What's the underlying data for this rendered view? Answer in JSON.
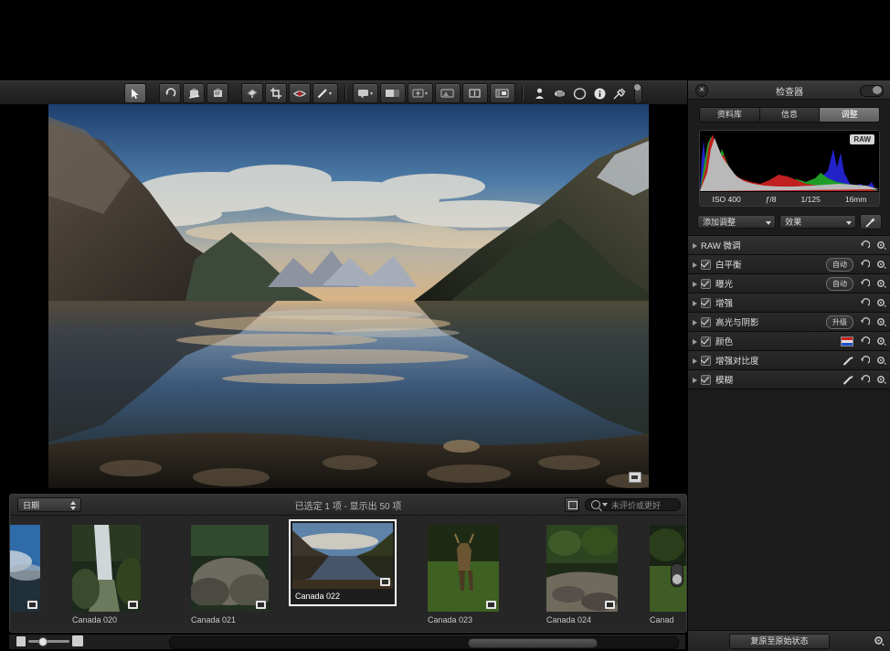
{
  "toolbar": {
    "tools": [
      {
        "name": "select-arrow-tool",
        "selected": true
      },
      {
        "name": "rotate-left-tool",
        "selected": false
      },
      {
        "name": "straighten-tool",
        "selected": false
      },
      {
        "name": "flip-tool",
        "selected": false
      },
      {
        "name": "lift-stamp-tool",
        "selected": false
      },
      {
        "name": "crop-tool",
        "selected": false
      },
      {
        "name": "red-eye-tool",
        "selected": false
      },
      {
        "name": "retouch-brush-tool",
        "selected": false
      },
      {
        "name": "quick-preview-tool",
        "selected": false
      },
      {
        "name": "primary-viewer-tool",
        "selected": false
      },
      {
        "name": "zoom-tool",
        "selected": false
      },
      {
        "name": "compare-tool",
        "selected": false
      },
      {
        "name": "loupe-tool",
        "selected": false
      },
      {
        "name": "metadata-overlay-tool",
        "selected": false
      },
      {
        "name": "full-screen-tool",
        "selected": false
      },
      {
        "name": "keywords-tool",
        "selected": false
      },
      {
        "name": "rotate-view-tool",
        "selected": false
      },
      {
        "name": "info-tool",
        "selected": false
      },
      {
        "name": "color-picker-tool",
        "selected": false
      }
    ]
  },
  "viewer": {
    "photo_alt": "Canada 022 - mountain lake reflection at sunrise",
    "badge_name": "version-badge"
  },
  "filmstrip": {
    "sort_label": "日期",
    "count_text": "已选定 1 项 - 显示出 50 项",
    "search_placeholder": "未评价或更好",
    "search_value": "未评价或更好",
    "thumbnails": [
      {
        "label": "",
        "partial": true,
        "side": "left"
      },
      {
        "label": "Canada 020",
        "selected": false
      },
      {
        "label": "Canada 021",
        "selected": false
      },
      {
        "label": "Canada 022",
        "selected": true
      },
      {
        "label": "Canada 023",
        "selected": false
      },
      {
        "label": "Canada 024",
        "selected": false
      },
      {
        "label": "Canad",
        "selected": false,
        "partial": true,
        "side": "right"
      }
    ]
  },
  "inspector": {
    "title": "检查器",
    "tabs": [
      {
        "label": "资料库",
        "active": false
      },
      {
        "label": "信息",
        "active": false
      },
      {
        "label": "调整",
        "active": true
      }
    ],
    "histogram": {
      "raw_tag": "RAW",
      "exif": [
        "ISO 400",
        "ƒ/8",
        "1/125",
        "16mm"
      ],
      "channels": [
        "red",
        "green",
        "blue",
        "luminance"
      ]
    },
    "controls": {
      "add_adjustment": "添加调整",
      "effects": "效果",
      "auto_enhance_icon": "wand-icon"
    },
    "adjustments": [
      {
        "name": "RAW 微调",
        "checkbox": false,
        "badge": "",
        "extra": ""
      },
      {
        "name": "白平衡",
        "checkbox": true,
        "badge": "自动",
        "extra": ""
      },
      {
        "name": "曝光",
        "checkbox": true,
        "badge": "自动",
        "extra": ""
      },
      {
        "name": "增强",
        "checkbox": true,
        "badge": "",
        "extra": ""
      },
      {
        "name": "高光与阴影",
        "checkbox": true,
        "badge": "升级",
        "extra": ""
      },
      {
        "name": "颜色",
        "checkbox": true,
        "badge": "",
        "extra": "color-swatch"
      },
      {
        "name": "增强对比度",
        "checkbox": true,
        "badge": "",
        "extra": "brush"
      },
      {
        "name": "模糊",
        "checkbox": true,
        "badge": "",
        "extra": "brush"
      }
    ],
    "footer": {
      "restore_label": "复原至原始状态",
      "gear_icon": "gear-icon"
    }
  },
  "colors": {
    "panel_bg": "#1c1c1c",
    "toolbar_bg": "#2e2e2e",
    "accent_selected": "#ffffff",
    "histogram_red": "#c0201f",
    "histogram_green": "#1f9e27",
    "histogram_blue": "#2222c8",
    "histogram_luma": "#b9b9b9"
  }
}
